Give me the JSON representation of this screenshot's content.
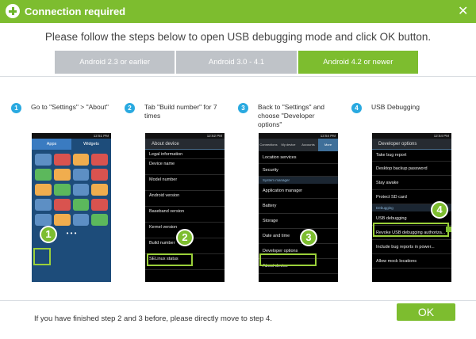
{
  "window": {
    "title": "Connection required",
    "close_glyph": "✕"
  },
  "instruction": "Please follow the steps below to open USB debugging mode and click OK button.",
  "tabs": [
    {
      "label": "Android 2.3 or earlier",
      "active": false
    },
    {
      "label": "Android 3.0 - 4.1",
      "active": false
    },
    {
      "label": "Android 4.2 or newer",
      "active": true
    }
  ],
  "steps": [
    {
      "num": "1",
      "text": "Go to \"Settings\" > \"About\""
    },
    {
      "num": "2",
      "text": "Tab \"Build number\" for 7 times"
    },
    {
      "num": "3",
      "text": "Back to \"Settings\" and choose \"Developer options\""
    },
    {
      "num": "4",
      "text": "USB Debugging"
    }
  ],
  "phones": {
    "p1": {
      "time": "12:51 PM",
      "tab_apps": "Apps",
      "tab_widgets": "Widgets",
      "dots": "• • •",
      "badge": "1"
    },
    "p2": {
      "time": "12:52 PM",
      "header": "About device",
      "rows": [
        "Legal information",
        "Device name",
        "Model number",
        "Android version",
        "Baseband version",
        "Kernel version",
        "Build number",
        "SELinux status"
      ],
      "badge": "2"
    },
    "p3": {
      "time": "12:54 PM",
      "tabs": [
        "Connections",
        "My device",
        "Accounts",
        "More"
      ],
      "rows_top": [
        "Location services",
        "Security"
      ],
      "section": "System manager",
      "rows_bottom": [
        "Application manager",
        "Battery",
        "Storage",
        "Date and time",
        "Developer options",
        "About device"
      ],
      "badge": "3"
    },
    "p4": {
      "time": "12:54 PM",
      "header": "Developer options",
      "rows_top": [
        "Take bug report",
        "Desktop backup password",
        "Stay awake",
        "Protect SD card"
      ],
      "section": "Debugging",
      "rows_bottom": [
        "USB debugging",
        "Revoke USB debugging authoriza...",
        "Include bug reports in power...",
        "Allow mock locations"
      ],
      "badge": "4"
    }
  },
  "footer_note": "If you have finished step 2 and 3 before, please directly move to step 4.",
  "ok_label": "OK",
  "colors": {
    "accent": "#7dbd2f",
    "step_blue": "#29a9e0",
    "tab_inactive": "#bfc3c8"
  }
}
